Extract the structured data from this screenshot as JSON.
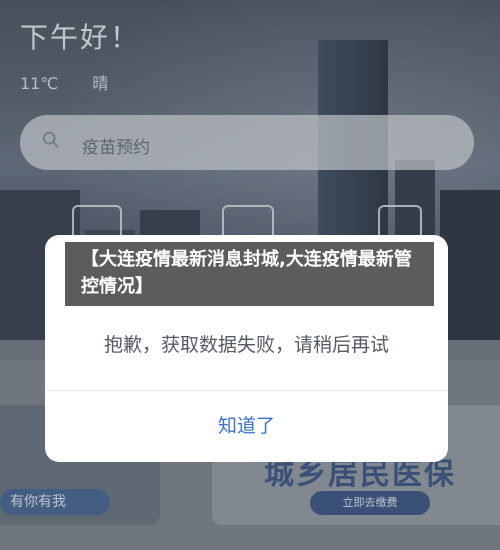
{
  "header": {
    "greeting": "下午好！"
  },
  "weather": {
    "temperature": "11℃",
    "condition": "晴"
  },
  "search": {
    "placeholder": "疫苗预约"
  },
  "banners": {
    "left_button": "有你有我",
    "right_title": "城乡居民医保",
    "right_button": "立即去缴费"
  },
  "dialog": {
    "title": "【大连疫情最新消息封城,大连疫情最新管控情况】",
    "message": "抱歉，获取数据失败，请稍后再试",
    "ok_label": "知道了"
  },
  "icons": [
    "search-icon",
    "scan-icon",
    "id-card-icon",
    "qr-code-icon"
  ]
}
